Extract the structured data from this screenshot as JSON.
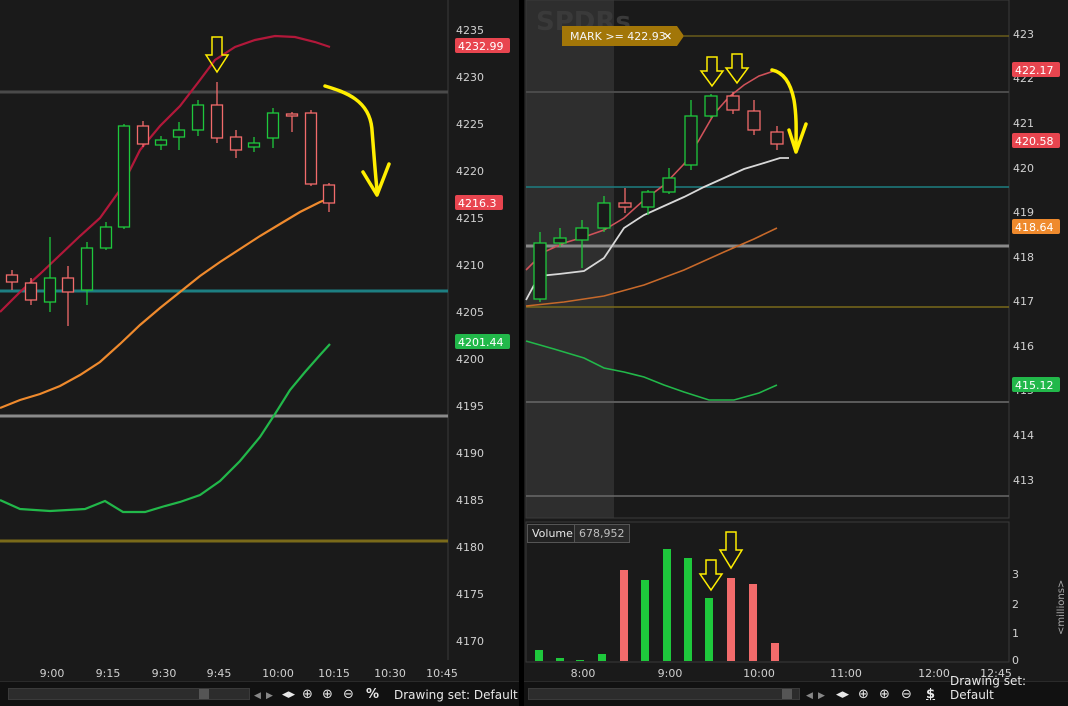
{
  "left_chart": {
    "price_axis_labels": [
      "4235",
      "4230",
      "4225",
      "4220",
      "4215",
      "4210",
      "4205",
      "4200",
      "4195",
      "4190",
      "4185",
      "4180",
      "4175",
      "4170"
    ],
    "time_axis_labels": [
      "9:00",
      "9:15",
      "9:30",
      "9:45",
      "10:00",
      "10:15",
      "10:30",
      "10:45"
    ],
    "price_tags": [
      {
        "text": "4232.99",
        "color": "#e8454f"
      },
      {
        "text": "4216.3",
        "color": "#e8454f"
      },
      {
        "text": "4201.44",
        "color": "#22b84a"
      }
    ],
    "drawing_set_label": "Drawing set: Default",
    "percent_symbol": "%"
  },
  "right_chart": {
    "watermark": "SPDRs",
    "alert_label": "MARK >= 422.93",
    "alert_close": "✕",
    "price_axis_labels": [
      "423",
      "422",
      "421",
      "420",
      "419",
      "418",
      "417",
      "416",
      "415",
      "414",
      "413"
    ],
    "price_tags": [
      {
        "text": "422.17",
        "color": "#e8454f"
      },
      {
        "text": "420.58",
        "color": "#e8454f"
      },
      {
        "text": "418.64",
        "color": "#ef8a2d"
      },
      {
        "text": "415.12",
        "color": "#22b84a"
      }
    ],
    "volume": {
      "title": "Volume",
      "value": "678,952",
      "axis_labels": [
        "3",
        "2",
        "1",
        "0"
      ],
      "unit_label": "<millions>"
    },
    "time_axis_labels": [
      "8:00",
      "9:00",
      "10:00",
      "11:00",
      "12:00",
      "12:45"
    ],
    "drawing_set_label": "Drawing set: Default",
    "dollar_symbol": "$"
  },
  "colors": {
    "bg": "#1a1a1a",
    "up": "#1ec83c",
    "down": "#f26b6b",
    "ma_fast": "#b2183a",
    "ma_mid": "#ef8a2d",
    "ma_slow": "#22b84a",
    "annotation": "#ffee00",
    "teal_line": "#1d7f82"
  },
  "icons": [
    "pan-arrows-icon",
    "crosshair-icon",
    "zoom-in-icon",
    "zoom-out-icon",
    "percent-icon",
    "dollar-icon"
  ]
}
